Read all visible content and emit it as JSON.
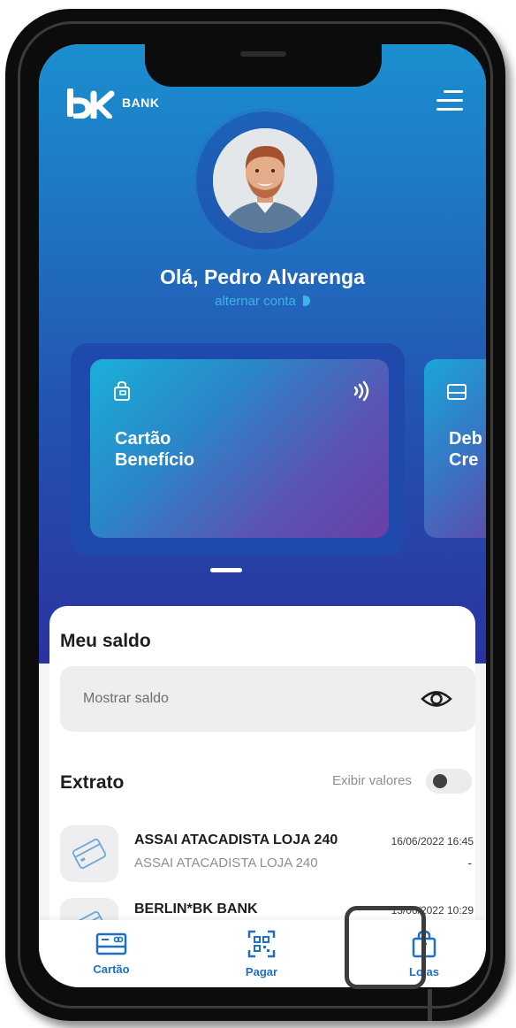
{
  "brand": {
    "name": "BANK",
    "logo": "bk-logo"
  },
  "header": {
    "menu_icon": "hamburger-menu-icon"
  },
  "profile": {
    "greeting": "Olá, Pedro Alvarenga",
    "switch_account": "alternar conta"
  },
  "cards": [
    {
      "title_line1": "Cartão",
      "title_line2": "Benefício",
      "icon": "shopping-bag-icon",
      "contactless_icon": "contactless-icon"
    },
    {
      "title_line1": "Deb",
      "title_line2": "Cre",
      "icon": "credit-card-icon"
    }
  ],
  "carousel": {
    "count": 3,
    "active_index": 0
  },
  "balance": {
    "title": "Meu saldo",
    "placeholder": "Mostrar saldo",
    "eye_icon": "eye-icon"
  },
  "statement": {
    "title": "Extrato",
    "toggle_label": "Exibir valores",
    "toggle_on": false,
    "transactions": [
      {
        "name": "ASSAI ATACADISTA  LOJA 240",
        "date": "16/06/2022 16:45",
        "description": "ASSAI ATACADISTA  LOJA 240",
        "value": "-",
        "icon": "credit-card-icon"
      },
      {
        "name": "BERLIN*BK BANK",
        "date": "13/06/2022 10:29",
        "description": "",
        "value": "",
        "icon": "credit-card-icon"
      }
    ]
  },
  "tabbar": {
    "items": [
      {
        "label": "Cartão",
        "icon": "card-icon"
      },
      {
        "label": "Pagar",
        "icon": "qr-code-icon"
      },
      {
        "label": "Lojas",
        "icon": "shopping-bag-icon"
      }
    ],
    "highlighted": "Lojas"
  },
  "colors": {
    "accent": "#1f6fc6",
    "gradient_top": "#1b8fd0",
    "gradient_bottom": "#2a33a0",
    "link": "#3fb2e8"
  }
}
